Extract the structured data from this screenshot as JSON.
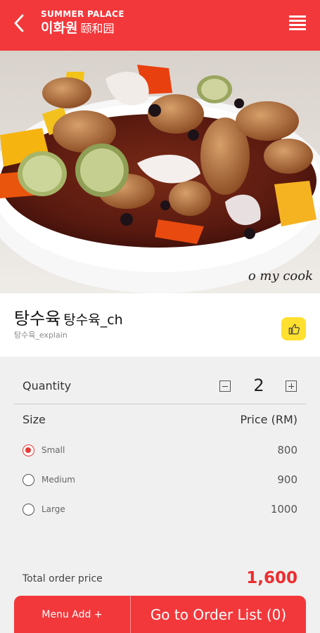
{
  "header": {
    "brand_en": "SUMMER PALACE",
    "brand_kr": "이화원",
    "brand_cn": "颐和园",
    "back_icon": "chevron-left-icon",
    "menu_icon": "hamburger-menu-icon",
    "color": "#f2383b"
  },
  "image": {
    "watermark": "o my cook"
  },
  "dish": {
    "name": "탕수육",
    "name_sub": "탕수육_ch",
    "explain": "탕수육_explain",
    "like_icon": "thumbs-up-icon",
    "like_color": "#ffe02e"
  },
  "quantity": {
    "label": "Quantity",
    "value": "2",
    "minus_icon": "minus-icon",
    "plus_icon": "plus-icon"
  },
  "size": {
    "label": "Size",
    "price_label": "Price (RM)",
    "options": [
      {
        "name": "Small",
        "price": "800",
        "selected": true
      },
      {
        "name": "Medium",
        "price": "900",
        "selected": false
      },
      {
        "name": "Large",
        "price": "1000",
        "selected": false
      }
    ]
  },
  "total": {
    "label": "Total order price",
    "value": "1,600",
    "color": "#ee2c2f"
  },
  "actions": {
    "menu_add": "Menu Add +",
    "order_list": "Go to Order List (0)"
  }
}
